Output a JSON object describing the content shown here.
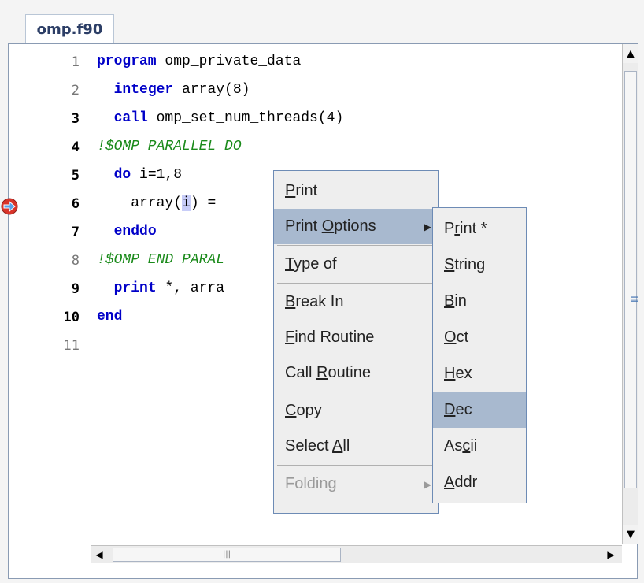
{
  "tab": {
    "title": "omp.f90"
  },
  "code": {
    "lines": [
      {
        "num": "1",
        "bold": false,
        "parts": [
          {
            "t": "program",
            "k": "kw"
          },
          {
            "t": " omp_private_data",
            "k": ""
          }
        ]
      },
      {
        "num": "2",
        "bold": false,
        "parts": [
          {
            "t": "  ",
            "k": ""
          },
          {
            "t": "integer",
            "k": "kw"
          },
          {
            "t": " array(8)",
            "k": ""
          }
        ]
      },
      {
        "num": "3",
        "bold": true,
        "parts": [
          {
            "t": "  ",
            "k": ""
          },
          {
            "t": "call",
            "k": "kw"
          },
          {
            "t": " omp_set_num_threads(4)",
            "k": ""
          }
        ]
      },
      {
        "num": "4",
        "bold": true,
        "parts": [
          {
            "t": "!$OMP PARALLEL DO",
            "k": "cm"
          }
        ]
      },
      {
        "num": "5",
        "bold": true,
        "parts": [
          {
            "t": "  ",
            "k": ""
          },
          {
            "t": "do",
            "k": "kw"
          },
          {
            "t": " i=1,8",
            "k": ""
          }
        ]
      },
      {
        "num": "6",
        "bold": true,
        "parts": [
          {
            "t": "    array(",
            "k": ""
          },
          {
            "t": "i",
            "k": "hl"
          },
          {
            "t": ") =",
            "k": ""
          }
        ]
      },
      {
        "num": "7",
        "bold": true,
        "parts": [
          {
            "t": "  ",
            "k": ""
          },
          {
            "t": "enddo",
            "k": "kw"
          }
        ]
      },
      {
        "num": "8",
        "bold": false,
        "parts": [
          {
            "t": "!$OMP END PARAL",
            "k": "cm"
          }
        ]
      },
      {
        "num": "9",
        "bold": true,
        "parts": [
          {
            "t": "  ",
            "k": ""
          },
          {
            "t": "print",
            "k": "kw"
          },
          {
            "t": " *, arra",
            "k": ""
          }
        ]
      },
      {
        "num": "10",
        "bold": true,
        "parts": [
          {
            "t": "end",
            "k": "kw"
          }
        ]
      },
      {
        "num": "11",
        "bold": false,
        "parts": []
      }
    ],
    "breakpoint_line": "6"
  },
  "context_menu": {
    "items": [
      {
        "label": "Print",
        "mnemonic": "P",
        "selected": false,
        "disabled": false,
        "submenu": false
      },
      {
        "label": "Print Options",
        "mnemonic": "O",
        "selected": true,
        "disabled": false,
        "submenu": true
      },
      {
        "label": "Type of",
        "mnemonic": "T",
        "selected": false,
        "disabled": false,
        "submenu": false
      },
      {
        "label": "Break In",
        "mnemonic": "B",
        "selected": false,
        "disabled": false,
        "submenu": false
      },
      {
        "label": "Find Routine",
        "mnemonic": "F",
        "selected": false,
        "disabled": false,
        "submenu": false
      },
      {
        "label": "Call Routine",
        "mnemonic": "R",
        "selected": false,
        "disabled": false,
        "submenu": false
      },
      {
        "label": "Copy",
        "mnemonic": "C",
        "selected": false,
        "disabled": false,
        "submenu": false
      },
      {
        "label": "Select All",
        "mnemonic": "A",
        "selected": false,
        "disabled": false,
        "submenu": false
      },
      {
        "label": "Folding",
        "mnemonic": "",
        "selected": false,
        "disabled": true,
        "submenu": true
      }
    ]
  },
  "print_options_menu": {
    "items": [
      {
        "label": "Print *",
        "mnemonic": "r",
        "selected": false
      },
      {
        "label": "String",
        "mnemonic": "S",
        "selected": false
      },
      {
        "label": "Bin",
        "mnemonic": "B",
        "selected": false
      },
      {
        "label": "Oct",
        "mnemonic": "O",
        "selected": false
      },
      {
        "label": "Hex",
        "mnemonic": "H",
        "selected": false
      },
      {
        "label": "Dec",
        "mnemonic": "D",
        "selected": true
      },
      {
        "label": "Ascii",
        "mnemonic": "c",
        "selected": false
      },
      {
        "label": "Addr",
        "mnemonic": "A",
        "selected": false
      }
    ]
  },
  "scrollbars": {
    "vertical": {
      "up": "▲",
      "down": "▼",
      "grip": "≡"
    },
    "horizontal": {
      "left": "◀",
      "right": "▶",
      "grip": "|||"
    }
  }
}
